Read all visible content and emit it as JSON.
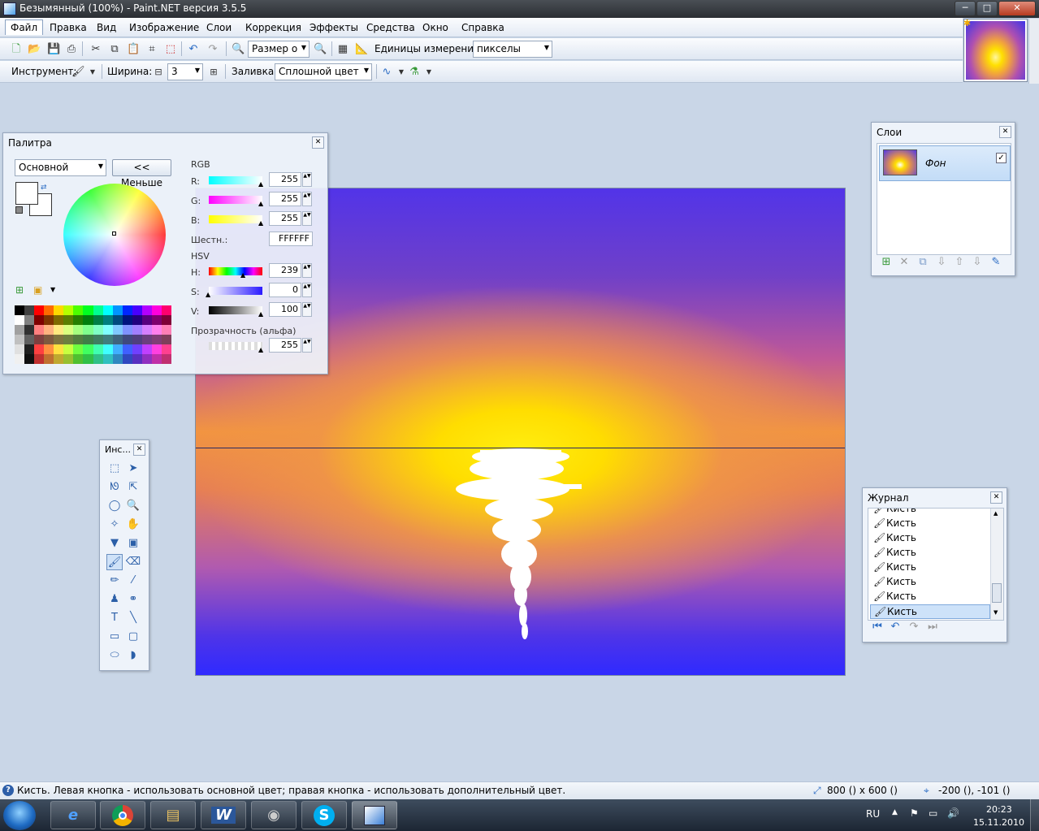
{
  "window": {
    "title": "Безымянный (100%) - Paint.NET версия 3.5.5",
    "minimize": "─",
    "maximize": "□",
    "close": "✕"
  },
  "menu": [
    "Файл",
    "Правка",
    "Вид",
    "Изображение",
    "Слои",
    "Коррекция",
    "Эффекты",
    "Средства",
    "Окно",
    "Справка"
  ],
  "toolbar1": {
    "zoom_combo": "Размер о",
    "units_label": "Единицы измерения:",
    "units_value": "пикселы"
  },
  "toolbar2": {
    "tool_label": "Инструмент:",
    "width_label": "Ширина:",
    "width_value": "3",
    "fill_label": "Заливка:",
    "fill_value": "Сплошной цвет"
  },
  "palette": {
    "title": "Палитра",
    "mode": "Основной",
    "less_button": "<< Меньше",
    "rgb_heading": "RGB",
    "r_label": "R:",
    "r_value": "255",
    "g_label": "G:",
    "g_value": "255",
    "b_label": "B:",
    "b_value": "255",
    "hex_label": "Шестн.:",
    "hex_value": "FFFFFF",
    "hsv_heading": "HSV",
    "h_label": "H:",
    "h_value": "239",
    "s_label": "S:",
    "s_value": "0",
    "v_label": "V:",
    "v_value": "100",
    "alpha_label": "Прозрачность (альфа)",
    "alpha_value": "255"
  },
  "layers": {
    "title": "Слои",
    "items": [
      {
        "name": "Фон",
        "visible": true
      }
    ]
  },
  "tools": {
    "title": "Инс..."
  },
  "history": {
    "title": "Журнал",
    "items": [
      "Кисть",
      "Кисть",
      "Кисть",
      "Кисть",
      "Кисть",
      "Кисть",
      "Кисть",
      "Кисть"
    ]
  },
  "status": {
    "hint": "Кисть. Левая кнопка - использовать основной цвет; правая кнопка - использовать дополнительный цвет.",
    "image_size": "800 () x 600 ()",
    "cursor_pos": "-200 (), -101 ()"
  },
  "taskbar": {
    "lang": "RU",
    "time": "20:23",
    "date": "15.11.2010"
  },
  "colors": {
    "primary": "#FFFFFF",
    "accent": "#2d5ea8"
  }
}
